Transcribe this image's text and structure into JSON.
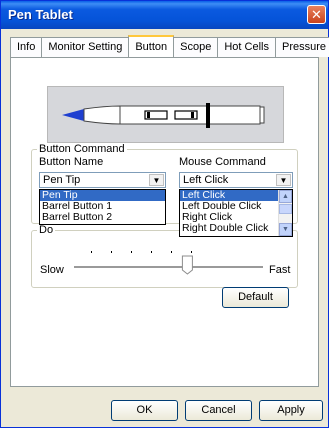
{
  "window": {
    "title": "Pen Tablet"
  },
  "tabs": [
    "Info",
    "Monitor Setting",
    "Button",
    "Scope",
    "Hot Cells",
    "Pressure"
  ],
  "active_tab_index": 2,
  "button_command": {
    "group_label": "Button Command",
    "button_name_label": "Button Name",
    "mouse_command_label": "Mouse Command",
    "button_name_value": "Pen Tip",
    "button_name_options": [
      "Pen Tip",
      "Barrel Button 1",
      "Barrel Button 2"
    ],
    "mouse_command_value": "Left Click",
    "mouse_command_options": [
      "Left Click",
      "Left Double Click",
      "Right Click",
      "Right Double Click"
    ]
  },
  "double_click": {
    "group_label_visible": "Do",
    "slow_label": "Slow",
    "fast_label": "Fast",
    "slider_value_fraction": 0.6
  },
  "buttons": {
    "default": "Default",
    "ok": "OK",
    "cancel": "Cancel",
    "apply": "Apply"
  },
  "colors": {
    "title_bar": "#0553d8",
    "selection": "#316ac5",
    "active_tab_accent": "#ffc83c",
    "pen_tip": "#1f3fd0"
  }
}
